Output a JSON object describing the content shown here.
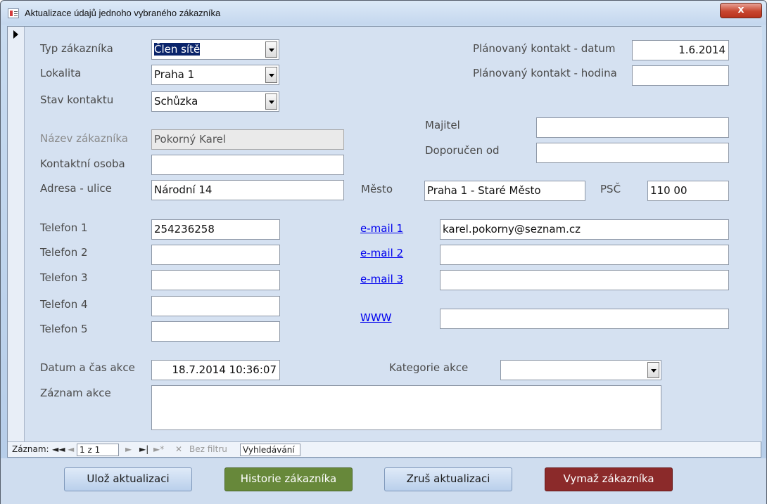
{
  "window": {
    "title": "Aktualizace údajů jednoho vybraného zákazníka",
    "close_label": "x"
  },
  "labels": {
    "typ_zakaznika": "Typ zákazníka",
    "lokalita": "Lokalita",
    "stav_kontaktu": "Stav kontaktu",
    "nazev_zakaznika": "Název zákazníka",
    "kontaktni_osoba": "Kontaktní osoba",
    "adresa_ulice": "Adresa - ulice",
    "telefon1": "Telefon 1",
    "telefon2": "Telefon 2",
    "telefon3": "Telefon 3",
    "telefon4": "Telefon 4",
    "telefon5": "Telefon 5",
    "datum_cas_akce": "Datum a čas akce",
    "zaznam_akce": "Záznam akce",
    "planovany_datum": "Plánovaný kontakt - datum",
    "planovany_hodina": "Plánovaný kontakt - hodina",
    "majitel": "Majitel",
    "doporucen_od": "Doporučen od",
    "mesto": "Město",
    "psc": "PSČ",
    "email1": "e-mail 1",
    "email2": "e-mail 2",
    "email3": "e-mail 3",
    "www": "WWW",
    "kategorie_akce": "Kategorie akce"
  },
  "values": {
    "typ_zakaznika": "Člen sítě",
    "lokalita": "Praha 1",
    "stav_kontaktu": "Schůzka",
    "nazev_zakaznika": "Pokorný Karel",
    "kontaktni_osoba": "",
    "adresa_ulice": "Národní 14",
    "telefon1": "254236258",
    "telefon2": "",
    "telefon3": "",
    "telefon4": "",
    "telefon5": "",
    "datum_cas_akce": "18.7.2014 10:36:07",
    "zaznam_akce": "",
    "planovany_datum": "1.6.2014",
    "planovany_hodina": "",
    "majitel": "",
    "doporucen_od": "",
    "mesto": "Praha 1 - Staré Město",
    "psc": "110 00",
    "email1": "karel.pokorny@seznam.cz",
    "email2": "",
    "email3": "",
    "www": "",
    "kategorie_akce": ""
  },
  "navigation": {
    "record_label": "Záznam:",
    "first": "◄◄",
    "prev": "◄",
    "position": "1 z 1",
    "next": "►",
    "last": "►|",
    "new": "►*",
    "filter_label": "Bez filtru",
    "search_label": "Vyhledávání"
  },
  "buttons": {
    "save": "Ulož aktualizaci",
    "history": "Historie zákazníka",
    "cancel": "Zruš aktualizaci",
    "delete": "Vymaž zákazníka"
  },
  "colors": {
    "history_button": "#67883a",
    "delete_button": "#8b2a2a",
    "link": "#0000ee"
  }
}
